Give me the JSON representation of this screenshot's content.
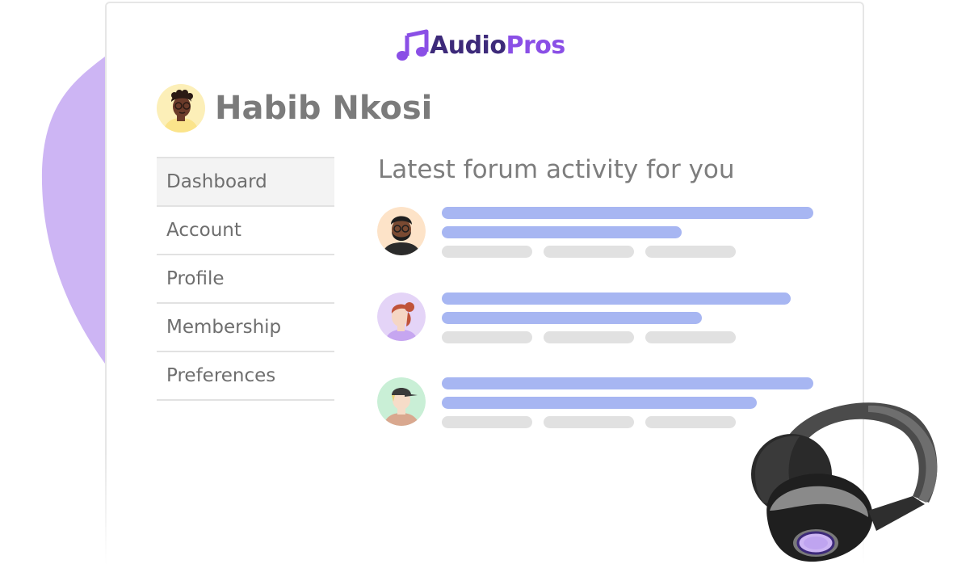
{
  "brand": {
    "name_part1": "Audio",
    "name_part2": "Pros",
    "colors": {
      "dark": "#3d2a7a",
      "accent": "#8a4fe6",
      "blob": "#cdb5f4"
    }
  },
  "user": {
    "name": "Habib Nkosi",
    "avatar_icon": "user-avatar"
  },
  "nav": {
    "items": [
      {
        "label": "Dashboard",
        "active": true
      },
      {
        "label": "Account"
      },
      {
        "label": "Profile"
      },
      {
        "label": "Membership"
      },
      {
        "label": "Preferences"
      }
    ]
  },
  "feed": {
    "heading": "Latest forum activity for you",
    "items": [
      {
        "avatar_icon": "bearded-man-avatar"
      },
      {
        "avatar_icon": "woman-avatar"
      },
      {
        "avatar_icon": "cap-man-avatar"
      }
    ]
  },
  "decor": {
    "headphones_icon": "headphones-icon"
  }
}
